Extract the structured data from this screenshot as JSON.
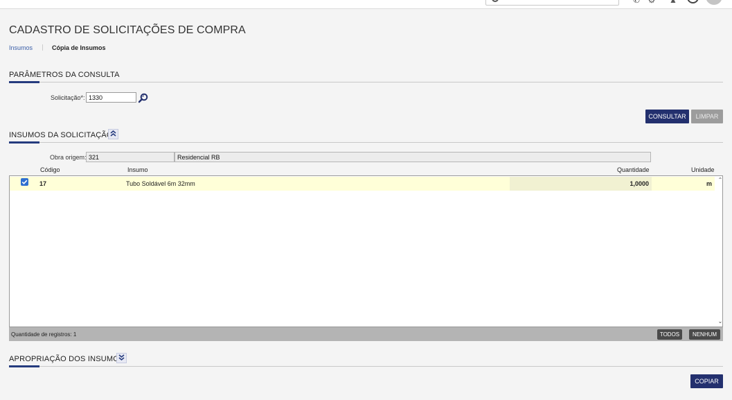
{
  "header": {
    "search_icon": "search-icon",
    "help_icon": "help-icon"
  },
  "page": {
    "title": "CADASTRO DE SOLICITAÇÕES DE COMPRA"
  },
  "breadcrumb": {
    "link": "Insumos",
    "current": "Cópia de Insumos"
  },
  "parametros": {
    "title": "PARÂMETROS DA CONSULTA",
    "solicitacao_label": "Solicitação*:",
    "solicitacao_value": "1330",
    "consultar_label": "CONSULTAR",
    "limpar_label": "LIMPAR"
  },
  "insumos": {
    "title": "INSUMOS DA SOLICITAÇÃO",
    "obra_label": "Obra origem:",
    "obra_code": "321",
    "obra_name": "Residencial RB",
    "columns": {
      "codigo": "Código",
      "insumo": "Insumo",
      "quantidade": "Quantidade",
      "unidade": "Unidade"
    },
    "rows": [
      {
        "checked": true,
        "codigo": "17",
        "insumo": "Tubo Soldável 6m 32mm",
        "quantidade": "1,0000",
        "unidade": "m"
      }
    ],
    "count_label": "Quantidade de registros: 1",
    "todos_label": "TODOS",
    "nenhum_label": "NENHUM"
  },
  "apropriacao": {
    "title": "APROPRIAÇÃO DOS INSUMOS",
    "copiar_label": "COPIAR"
  },
  "colors": {
    "primary": "#23306e",
    "row_highlight": "#ffffd8",
    "accent_line": "#253b7e"
  }
}
